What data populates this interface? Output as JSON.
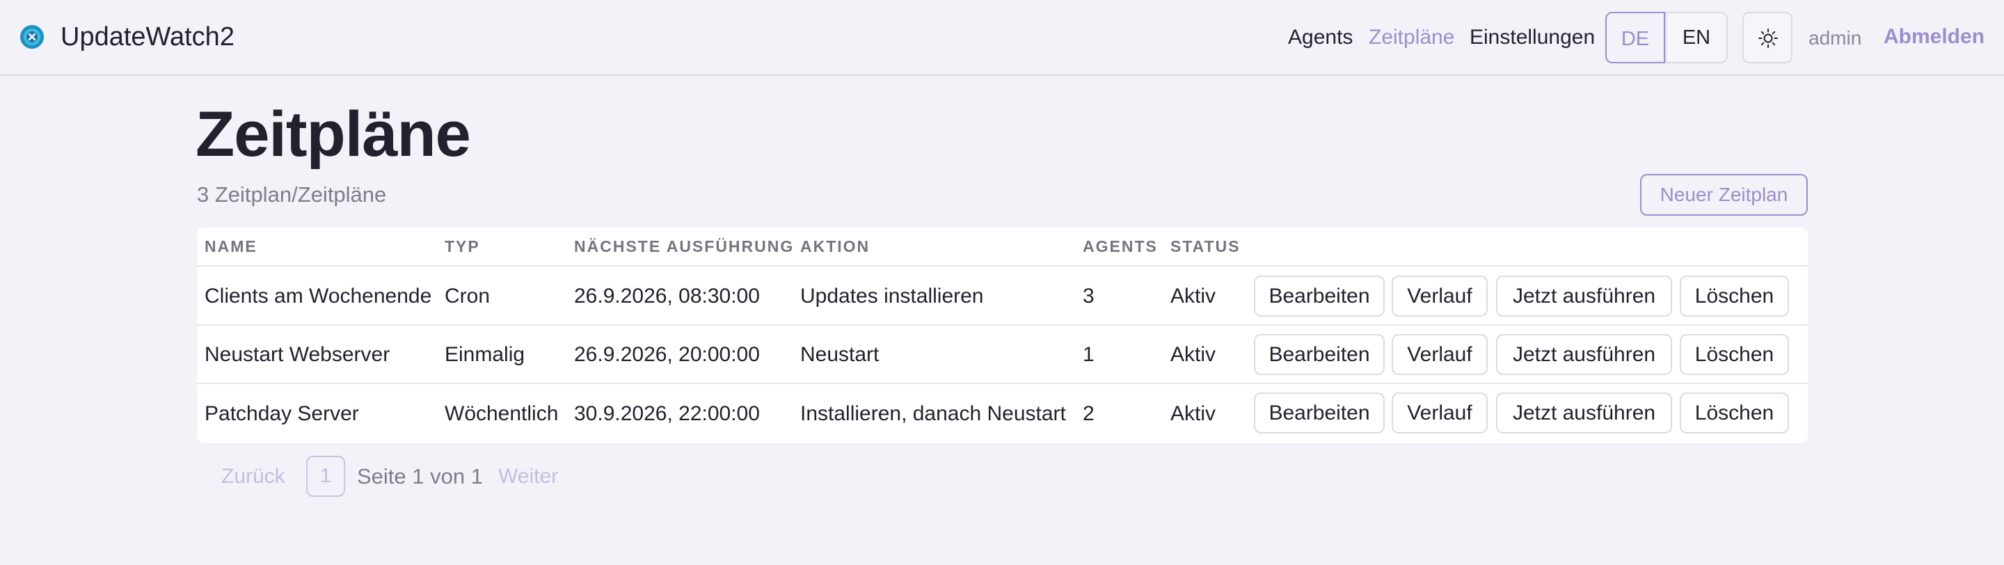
{
  "header": {
    "app_name": "UpdateWatch2",
    "nav": [
      {
        "label": "Agents",
        "active": false
      },
      {
        "label": "Zeitpläne",
        "active": true
      },
      {
        "label": "Einstellungen",
        "active": false
      }
    ],
    "languages": [
      {
        "label": "DE",
        "active": true
      },
      {
        "label": "EN",
        "active": false
      }
    ],
    "theme_icon": "sun-icon",
    "user": "admin",
    "logout_label": "Abmelden"
  },
  "main": {
    "title": "Zeitpläne",
    "subtitle": "3 Zeitplan/Zeitpläne",
    "new_button_label": "Neuer Zeitplan",
    "table": {
      "columns": [
        "NAME",
        "TYP",
        "NÄCHSTE AUSFÜHRUNG",
        "AKTION",
        "AGENTS",
        "STATUS"
      ],
      "action_labels": [
        "Bearbeiten",
        "Verlauf",
        "Jetzt ausführen",
        "Löschen"
      ],
      "rows": [
        {
          "name": "Clients am Wochenende",
          "type": "Cron",
          "next_run": "26.9.2026, 08:30:00",
          "action": "Updates installieren",
          "agents": "3",
          "status": "Aktiv"
        },
        {
          "name": "Neustart Webserver",
          "type": "Einmalig",
          "next_run": "26.9.2026, 20:00:00",
          "action": "Neustart",
          "agents": "1",
          "status": "Aktiv"
        },
        {
          "name": "Patchday Server",
          "type": "Wöchentlich",
          "next_run": "30.9.2026, 22:00:00",
          "action": "Installieren, danach Neustart",
          "agents": "2",
          "status": "Aktiv"
        }
      ]
    },
    "pagination": {
      "prev_label": "Zurück",
      "current_page": "1",
      "info": "Seite 1 von 1",
      "next_label": "Weiter"
    }
  },
  "colors": {
    "accent": "#9b8fcd",
    "background": "#f3f2f8",
    "text": "#23212e"
  }
}
